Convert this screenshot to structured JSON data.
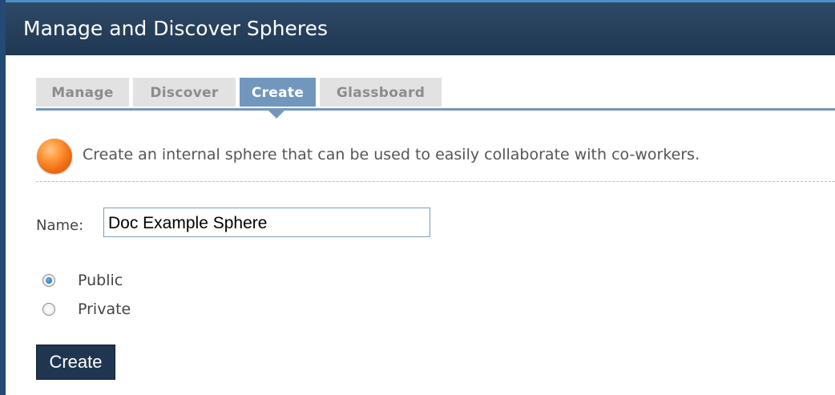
{
  "window": {
    "title": "Manage and Discover Spheres"
  },
  "tabs": [
    {
      "label": "Manage",
      "active": false
    },
    {
      "label": "Discover",
      "active": false
    },
    {
      "label": "Create",
      "active": true
    },
    {
      "label": "Glassboard",
      "active": false
    }
  ],
  "intro": {
    "icon": "orange-sphere-icon",
    "text": "Create an internal sphere that can be used to easily collaborate with co-workers."
  },
  "form": {
    "name_label": "Name:",
    "name_value": "Doc Example Sphere",
    "visibility_options": [
      {
        "label": "Public",
        "selected": true
      },
      {
        "label": "Private",
        "selected": false
      }
    ],
    "submit_label": "Create"
  },
  "colors": {
    "title_bar": "#1f3853",
    "active_tab": "#7297bf",
    "inactive_tab": "#e2e2e2",
    "button": "#1f3550",
    "orb": "#f06a10"
  }
}
